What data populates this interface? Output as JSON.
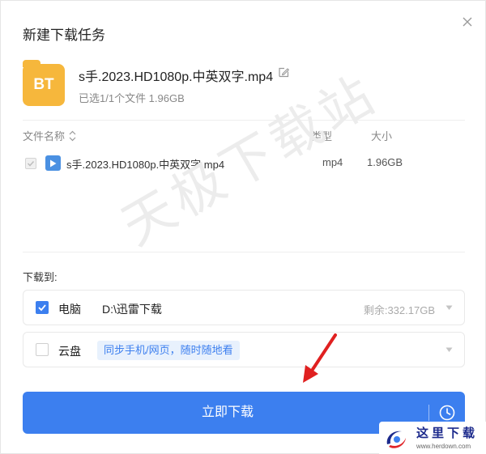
{
  "dialog": {
    "title": "新建下载任务",
    "close_icon": "close-icon"
  },
  "task": {
    "badge_text": "BT",
    "file_name": "s手.2023.HD1080p.中英双字.mp4",
    "summary": "已选1/1个文件 1.96GB"
  },
  "file_list": {
    "headers": {
      "name": "文件名称",
      "type": "类型",
      "size": "大小"
    },
    "rows": [
      {
        "checked": true,
        "name": "s手.2023.HD1080p.中英双字.mp4",
        "type": "mp4",
        "size": "1.96GB"
      }
    ]
  },
  "watermark_text": "天极下载站",
  "destination": {
    "label": "下载到:",
    "pc": {
      "checked": true,
      "label": "电脑",
      "path": "D:\\迅雷下载",
      "free_space": "剩余:332.17GB"
    },
    "cloud": {
      "checked": false,
      "label": "云盘",
      "sync_tag": "同步手机/网页，随时随地看"
    }
  },
  "download_button": {
    "label": "立即下载"
  },
  "site_logo": {
    "name": "这里下载",
    "url": "www.herdown.com"
  },
  "colors": {
    "accent": "#3c7fef",
    "folder": "#f6b73c",
    "annotation_arrow": "#e02020"
  }
}
